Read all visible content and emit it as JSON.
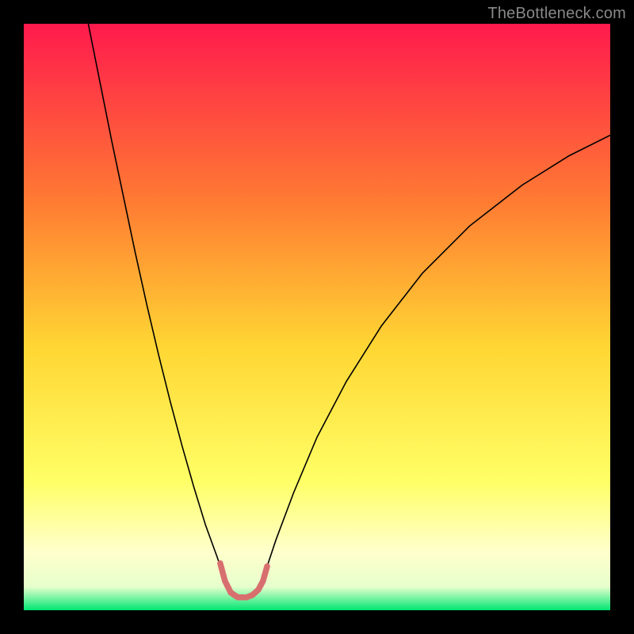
{
  "watermark": "TheBottleneck.com",
  "chart_data": {
    "type": "line",
    "title": "",
    "xlabel": "",
    "ylabel": "",
    "xlim": [
      0,
      100
    ],
    "ylim": [
      0,
      100
    ],
    "background_gradient": {
      "stops": [
        {
          "offset": 0.0,
          "color": "#ff1a4d"
        },
        {
          "offset": 0.3,
          "color": "#ff7a33"
        },
        {
          "offset": 0.55,
          "color": "#ffd633"
        },
        {
          "offset": 0.78,
          "color": "#ffff66"
        },
        {
          "offset": 0.9,
          "color": "#ffffcc"
        },
        {
          "offset": 0.96,
          "color": "#e6ffcc"
        },
        {
          "offset": 1.0,
          "color": "#00e673"
        }
      ]
    },
    "series": [
      {
        "name": "curve-left",
        "style": {
          "stroke": "#000000",
          "width": 1.6
        },
        "x": [
          11.0,
          13.0,
          15.0,
          17.0,
          19.0,
          21.0,
          23.0,
          25.0,
          27.0,
          29.0,
          31.0,
          33.0,
          34.0,
          35.0
        ],
        "y": [
          100.0,
          90.0,
          80.0,
          70.5,
          61.0,
          52.0,
          43.5,
          35.5,
          28.0,
          21.0,
          14.5,
          9.0,
          6.0,
          3.5
        ]
      },
      {
        "name": "curve-right",
        "style": {
          "stroke": "#000000",
          "width": 1.6
        },
        "x": [
          40.0,
          41.0,
          43.0,
          46.0,
          50.0,
          55.0,
          61.0,
          68.0,
          76.0,
          85.0,
          93.0,
          100.0
        ],
        "y": [
          3.5,
          6.0,
          12.0,
          20.0,
          29.5,
          39.0,
          48.5,
          57.5,
          65.5,
          72.5,
          77.5,
          81.0
        ]
      },
      {
        "name": "highlight-segment",
        "style": {
          "stroke": "#d86f6f",
          "width": 7.5,
          "linecap": "round"
        },
        "x": [
          33.5,
          34.3,
          35.3,
          36.5,
          38.0,
          39.0,
          40.0,
          40.8,
          41.5
        ],
        "y": [
          8.0,
          5.0,
          3.0,
          2.2,
          2.2,
          2.6,
          3.5,
          5.0,
          7.5
        ]
      }
    ]
  }
}
